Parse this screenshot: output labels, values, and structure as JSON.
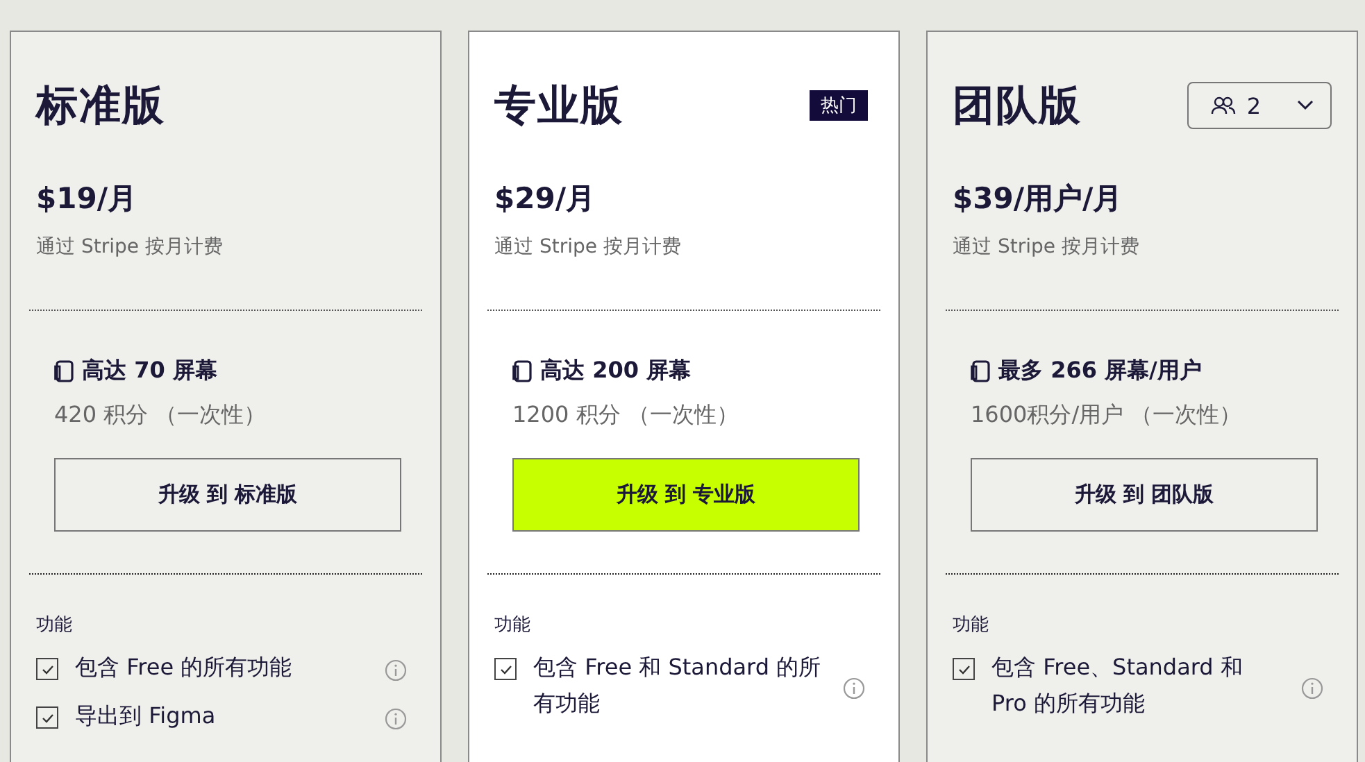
{
  "plans": [
    {
      "name": "标准版",
      "featured": false,
      "price": "$19/月",
      "billing": "通过 Stripe 按月计费",
      "screens": "高达 70 屏幕",
      "credits": "420 积分 （一次性）",
      "button": "升级 到 标准版",
      "features_heading": "功能",
      "features": [
        {
          "text": "包含 Free 的所有功能",
          "checked": true
        },
        {
          "text": "导出到 Figma",
          "checked": true
        }
      ]
    },
    {
      "name": "专业版",
      "badge": "热门",
      "featured": true,
      "price": "$29/月",
      "billing": "通过 Stripe 按月计费",
      "screens": "高达 200 屏幕",
      "credits": "1200 积分 （一次性）",
      "button": "升级 到 专业版",
      "features_heading": "功能",
      "features": [
        {
          "text": "包含 Free 和 Standard 的所有功能",
          "checked": true
        }
      ]
    },
    {
      "name": "团队版",
      "seats": "2",
      "featured": false,
      "price": "$39/用户/月",
      "billing": "通过 Stripe 按月计费",
      "screens": "最多 266 屏幕/用户",
      "credits": "1600积分/用户 （一次性）",
      "button": "升级 到 团队版",
      "features_heading": "功能",
      "features": [
        {
          "text": "包含 Free、Standard 和 Pro 的所有功能",
          "checked": true
        }
      ]
    }
  ]
}
